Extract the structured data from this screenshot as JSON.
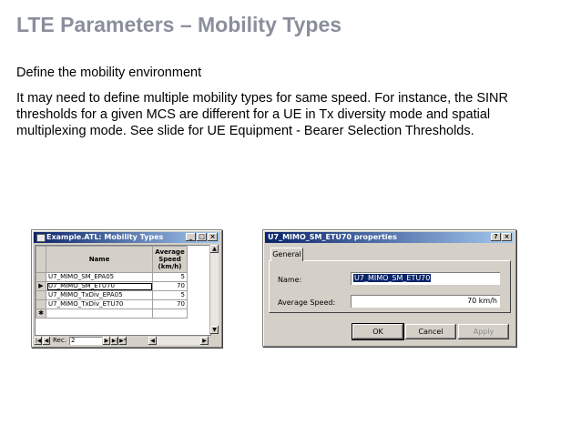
{
  "slide": {
    "title": "LTE Parameters – Mobility Types",
    "paragraph1": "Define the mobility environment",
    "paragraph2": "It may need to define multiple mobility types for same speed. For instance, the SINR thresholds for a given MCS are different for a UE in Tx diversity mode and spatial multiplexing mode. See slide for UE Equipment - Bearer Selection Thresholds."
  },
  "types_window": {
    "title": "Example.ATL: Mobility Types",
    "title_buttons": [
      "_",
      "□",
      "×"
    ],
    "columns": {
      "name": "Name",
      "speed": "Average Speed (km/h)"
    },
    "rows": [
      {
        "name": "U7_MIMO_SM_EPA05",
        "speed": "5"
      },
      {
        "name": "U7_MIMO_SM_ETU70",
        "speed": "70"
      },
      {
        "name": "U7_MIMO_TxDiv_EPA05",
        "speed": "5"
      },
      {
        "name": "U7_MIMO_TxDiv_ETU70",
        "speed": "70"
      }
    ],
    "current_row_marker": "▶",
    "new_row_marker": "✱",
    "navigator": {
      "label": "Rec.",
      "value": "2"
    }
  },
  "props_dialog": {
    "title": "U7_MIMO_SM_ETU70 properties",
    "title_buttons": [
      "?",
      "×"
    ],
    "tab": "General",
    "name_label": "Name:",
    "name_value": "U7_MIMO_SM_ETU70",
    "speed_label": "Average Speed:",
    "speed_value": "70 km/h",
    "ok": "OK",
    "cancel": "Cancel",
    "apply": "Apply"
  }
}
